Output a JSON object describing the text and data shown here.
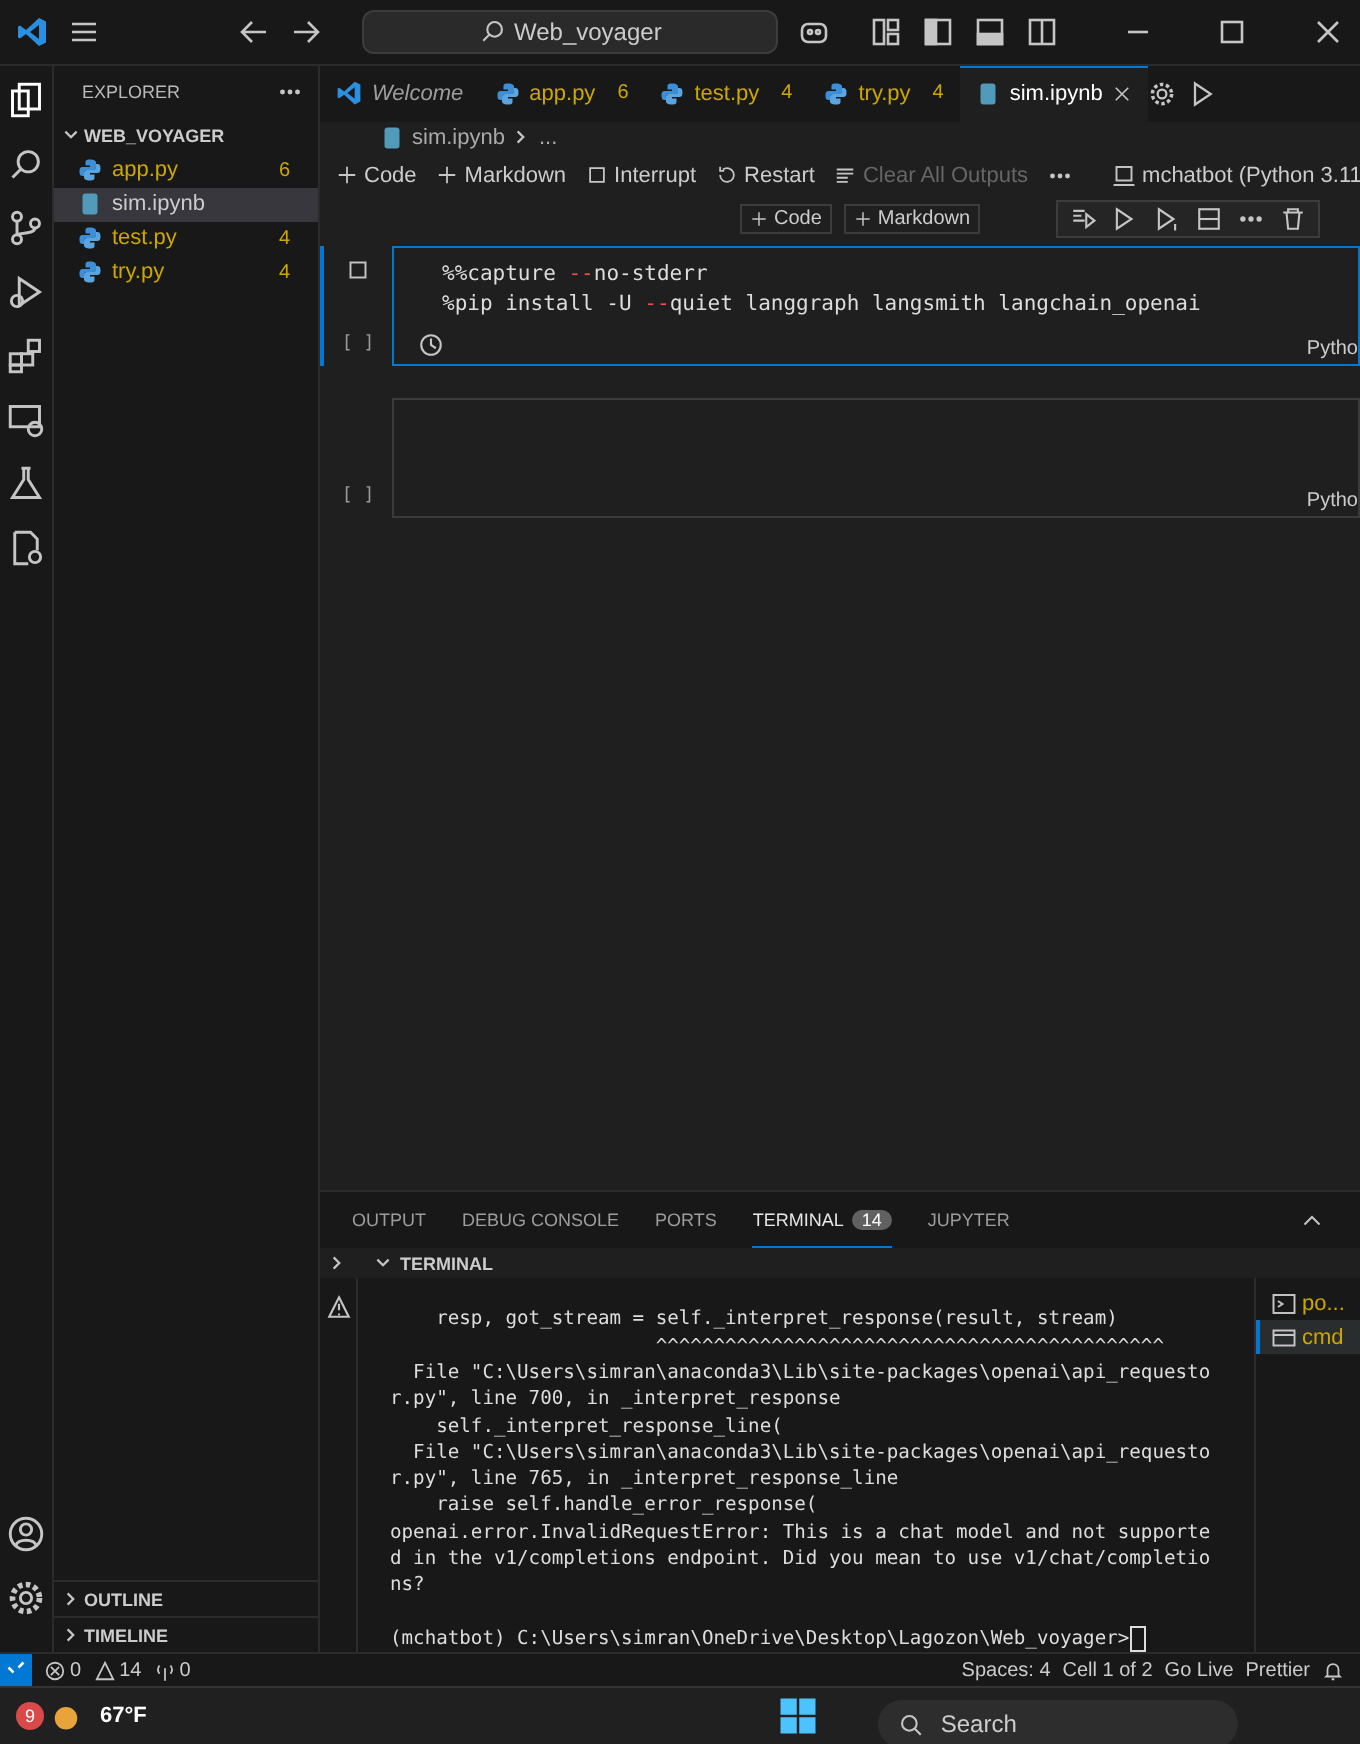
{
  "title_bar": {
    "search": "Web_voyager"
  },
  "sidebar": {
    "title": "EXPLORER",
    "folder": "WEB_VOYAGER",
    "expanded": true,
    "files": [
      {
        "name": "app.py",
        "kind": "python",
        "badge": "6",
        "selected": false
      },
      {
        "name": "sim.ipynb",
        "kind": "notebook",
        "selected": true
      },
      {
        "name": "test.py",
        "kind": "python",
        "badge": "4",
        "selected": false
      },
      {
        "name": "try.py",
        "kind": "python",
        "badge": "4",
        "selected": false
      }
    ],
    "sections": [
      {
        "label": "OUTLINE",
        "expanded": false
      },
      {
        "label": "TIMELINE",
        "expanded": false
      }
    ]
  },
  "tabs": [
    {
      "label": "Welcome",
      "kind": "welcome",
      "selected": false
    },
    {
      "label": "app.py",
      "kind": "python",
      "badge": "6",
      "selected": false
    },
    {
      "label": "test.py",
      "kind": "python",
      "badge": "4",
      "selected": false
    },
    {
      "label": "try.py",
      "kind": "python",
      "badge": "4",
      "selected": false
    },
    {
      "label": "sim.ipynb",
      "kind": "notebook",
      "selected": true
    }
  ],
  "breadcrumb": [
    "sim.ipynb",
    "..."
  ],
  "notebook_toolbar": {
    "buttons": [
      {
        "label": "Code",
        "kind": "plus",
        "disabled": false
      },
      {
        "label": "Markdown",
        "kind": "plus",
        "disabled": false
      },
      {
        "label": "Interrupt",
        "kind": "stop",
        "disabled": false
      },
      {
        "label": "Restart",
        "kind": "restart",
        "disabled": false
      },
      {
        "label": "Clear All Outputs",
        "kind": "clear",
        "disabled": true
      }
    ],
    "kernel": "mchatbot (Python 3.11"
  },
  "insert_buttons": [
    "Code",
    "Markdown"
  ],
  "cells": [
    {
      "execution": "[ ]",
      "language": "Pytho",
      "selected": true,
      "lines": [
        [
          {
            "text": "%%capture ",
            "kind": "plain"
          },
          {
            "text": "--",
            "kind": "operator"
          },
          {
            "text": "no-stderr",
            "kind": "plain"
          }
        ],
        [
          {
            "text": "%pip install -U ",
            "kind": "plain"
          },
          {
            "text": "--",
            "kind": "operator"
          },
          {
            "text": "quiet langgraph langsmith langchain_openai",
            "kind": "plain"
          }
        ]
      ]
    },
    {
      "execution": "[ ]",
      "language": "Pytho",
      "selected": false
    }
  ],
  "panel": {
    "tabs": [
      {
        "label": "OUTPUT",
        "selected": false
      },
      {
        "label": "DEBUG CONSOLE",
        "selected": false
      },
      {
        "label": "PORTS",
        "selected": false
      },
      {
        "label": "TERMINAL",
        "badge": "14",
        "selected": true
      },
      {
        "label": "JUPYTER",
        "selected": false
      }
    ],
    "section": "TERMINAL",
    "terminal_lines": [
      "    resp, got_stream = self._interpret_response(result, stream)",
      "                       ^^^^^^^^^^^^^^^^^^^^^^^^^^^^^^^^^^^^^^^^^^^^",
      "  File \"C:\\Users\\simran\\anaconda3\\Lib\\site-packages\\openai\\api_requesto",
      "r.py\", line 700, in _interpret_response",
      "    self._interpret_response_line(",
      "  File \"C:\\Users\\simran\\anaconda3\\Lib\\site-packages\\openai\\api_requesto",
      "r.py\", line 765, in _interpret_response_line",
      "    raise self.handle_error_response(",
      "openai.error.InvalidRequestError: This is a chat model and not supporte",
      "d in the v1/completions endpoint. Did you mean to use v1/chat/completio",
      "ns?"
    ],
    "prompt": "(mchatbot) C:\\Users\\simran\\OneDrive\\Desktop\\Lagozon\\Web_voyager>",
    "terminals": [
      {
        "label": "po...",
        "kind": "powershell",
        "selected": false
      },
      {
        "label": "cmd",
        "kind": "cmd",
        "selected": true
      }
    ]
  },
  "status_bar": {
    "errors": "0",
    "warnings": "14",
    "ports": "0",
    "items": [
      "Spaces: 4",
      "Cell 1 of 2",
      "Go Live",
      "Prettier"
    ]
  },
  "taskbar": {
    "notification": "9",
    "temperature": "67°F",
    "search_placeholder": "Search"
  }
}
